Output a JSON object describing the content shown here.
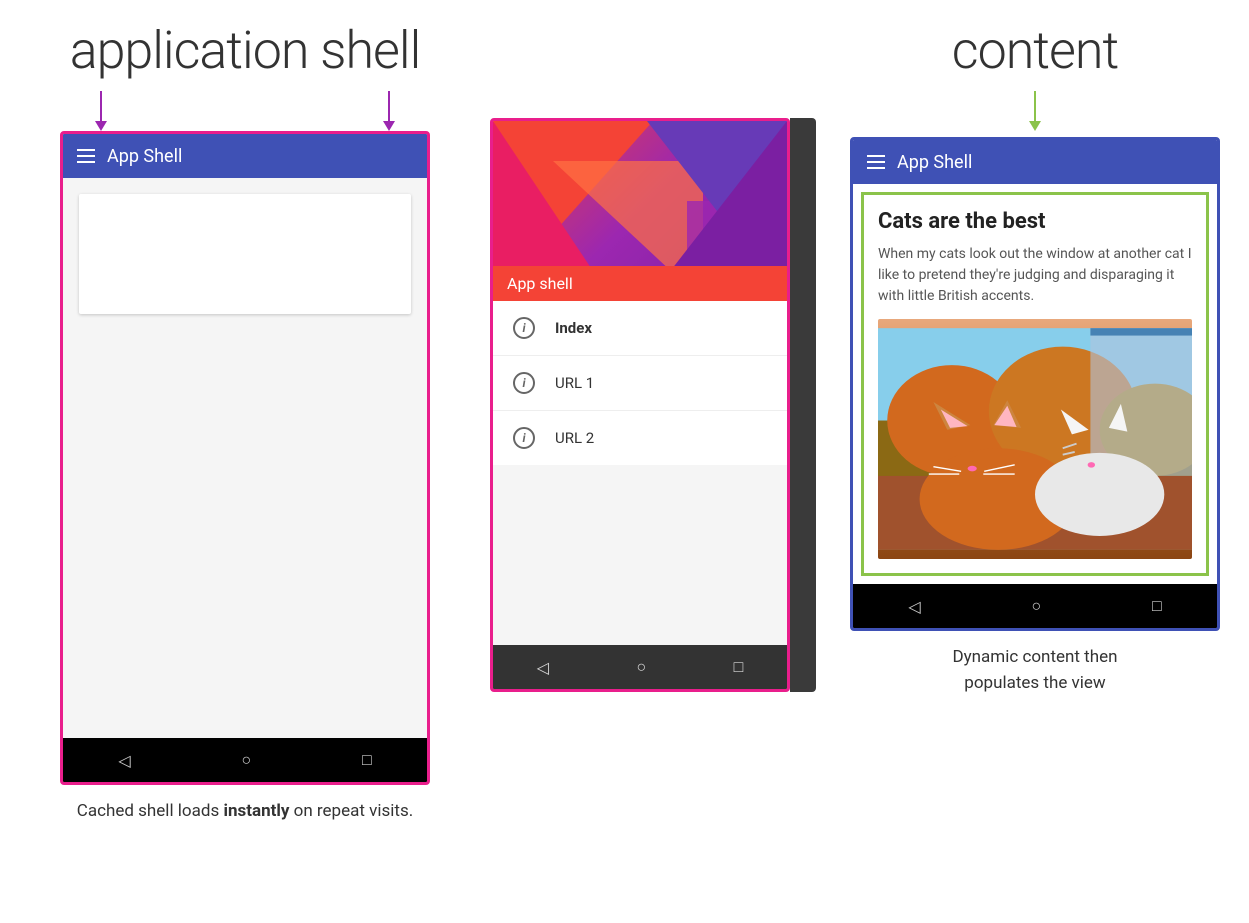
{
  "labels": {
    "application_shell": "application shell",
    "content": "content"
  },
  "phone1": {
    "topbar_title": "App Shell",
    "caption": "Cached shell loads instantly on repeat visits."
  },
  "phone2": {
    "app_shell_banner": "App shell",
    "menu_items": [
      {
        "label": "Index",
        "active": true
      },
      {
        "label": "URL 1",
        "active": false
      },
      {
        "label": "URL 2",
        "active": false
      }
    ]
  },
  "phone3": {
    "topbar_title": "App Shell",
    "content_title": "Cats are the best",
    "content_body": "When my cats look out the window at another cat I like to pretend they're judging and disparaging it with little British accents.",
    "caption_line1": "Dynamic content then",
    "caption_line2": "populates the view"
  },
  "nav_buttons": {
    "back": "◁",
    "home": "○",
    "recent": "□"
  }
}
